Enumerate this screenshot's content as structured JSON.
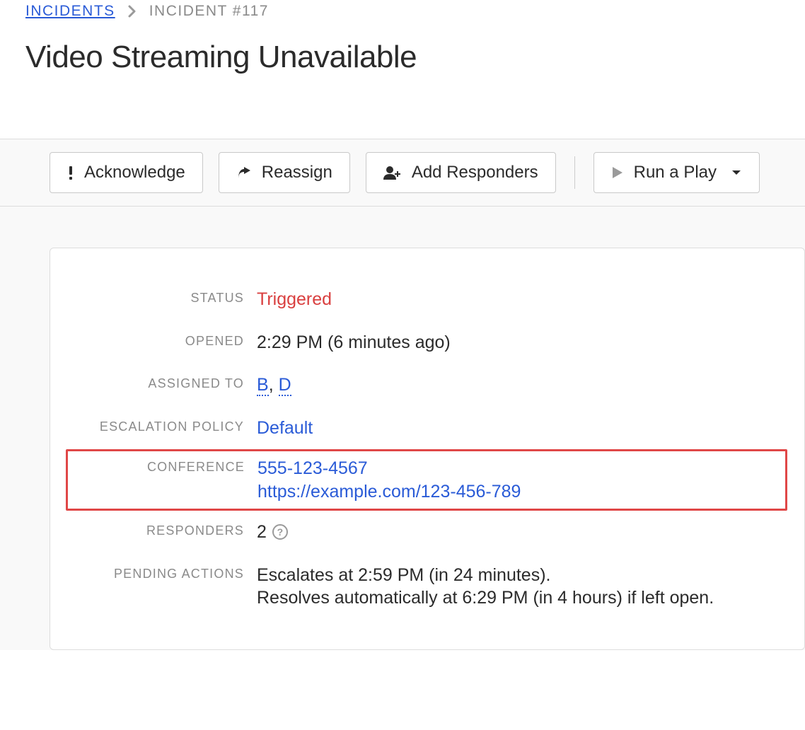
{
  "breadcrumb": {
    "root_label": "INCIDENTS",
    "current_label": "INCIDENT #117"
  },
  "page_title": "Video Streaming Unavailable",
  "toolbar": {
    "acknowledge_label": "Acknowledge",
    "reassign_label": "Reassign",
    "add_responders_label": "Add Responders",
    "run_play_label": "Run a Play"
  },
  "details": {
    "status_label": "STATUS",
    "status_value": "Triggered",
    "opened_label": "OPENED",
    "opened_value": "2:29 PM (6 minutes ago)",
    "assigned_label": "ASSIGNED TO",
    "assigned_to": [
      "B",
      "D"
    ],
    "assigned_sep": ", ",
    "escalation_label": "ESCALATION POLICY",
    "escalation_value": "Default",
    "conference_label": "CONFERENCE",
    "conference_phone": "555-123-4567",
    "conference_url": "https://example.com/123-456-789",
    "responders_label": "RESPONDERS",
    "responders_count": "2",
    "help_glyph": "?",
    "pending_label": "PENDING ACTIONS",
    "pending_line1": "Escalates at 2:59 PM (in 24 minutes).",
    "pending_line2": "Resolves automatically at 6:29 PM (in 4 hours) if left open."
  }
}
